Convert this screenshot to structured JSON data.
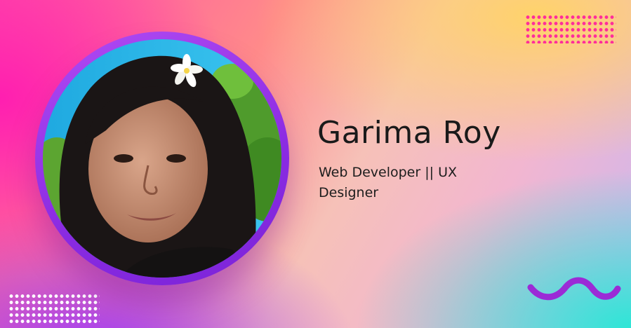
{
  "profile": {
    "name": "Garima Roy",
    "role": "Web Developer || UX Designer"
  },
  "colors": {
    "ring": "#8a2be2",
    "wave": "#9b2bd6",
    "dots_top_right": "#ff2d9a",
    "dots_bottom_left": "#ffffff"
  },
  "icons": {
    "decor_top_right": "dot-grid",
    "decor_bottom_left": "dot-grid",
    "decor_bottom_right": "wave-squiggle"
  }
}
